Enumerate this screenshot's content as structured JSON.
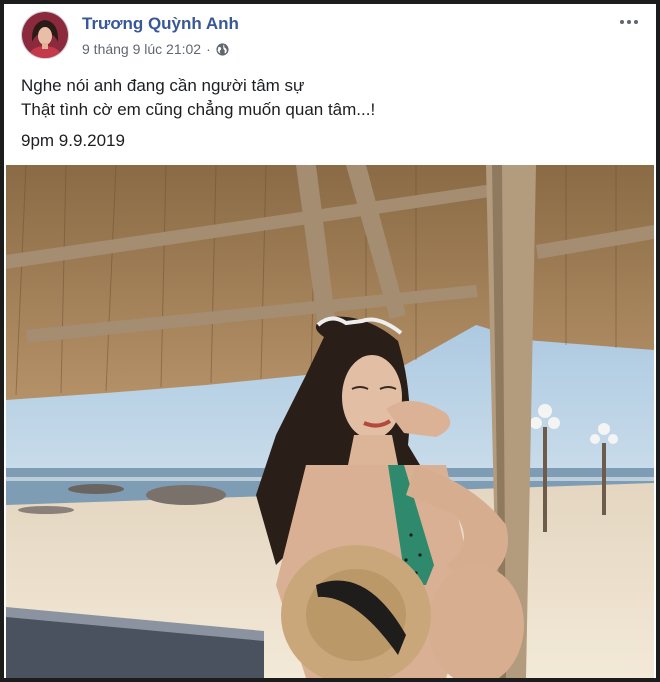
{
  "post": {
    "author": "Trương Quỳnh Anh",
    "timestamp": "9 tháng 9 lúc 21:02",
    "separator": "·",
    "privacy_icon": "globe-icon",
    "more_icon": "ellipsis-icon",
    "lines": [
      "Nghe nói anh đang cần người tâm sự",
      "Thật tình cờ em cũng chẳng muốn quan tâm...!"
    ],
    "date_line": "9pm 9.9.2019"
  },
  "colors": {
    "author": "#385898",
    "meta": "#606770",
    "text": "#1c1e21"
  }
}
